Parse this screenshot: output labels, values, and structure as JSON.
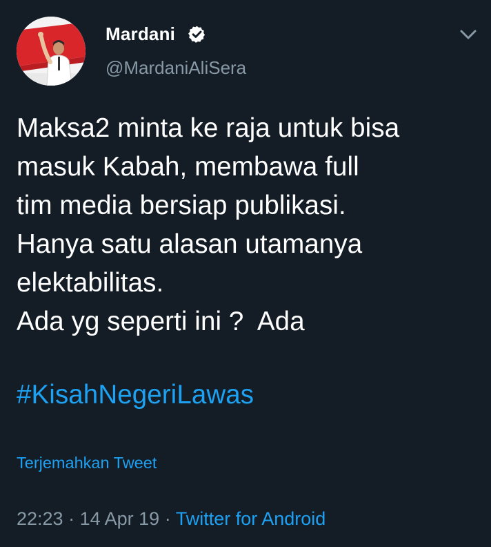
{
  "colors": {
    "background": "#141d26",
    "primary_text": "#ffffff",
    "secondary_text": "#8899a6",
    "link": "#1da1f2"
  },
  "author": {
    "display_name": "Mardani",
    "username": "@MardaniAliSera",
    "verified": true,
    "avatar_icon": "profile-photo"
  },
  "tweet": {
    "lines": [
      "Maksa2 minta ke raja untuk bisa",
      "masuk Kabah, membawa full",
      "tim media bersiap publikasi.",
      "Hanya satu alasan utamanya",
      "elektabilitas.",
      "Ada yg seperti ini ?  Ada"
    ],
    "hashtag": "#KisahNegeriLawas"
  },
  "translate_label": "Terjemahkan Tweet",
  "meta": {
    "time": "22:23",
    "separator": "·",
    "date": "14 Apr 19",
    "source": "Twitter for Android"
  },
  "icons": {
    "verified": "verified-badge-icon",
    "more": "chevron-down-icon"
  }
}
